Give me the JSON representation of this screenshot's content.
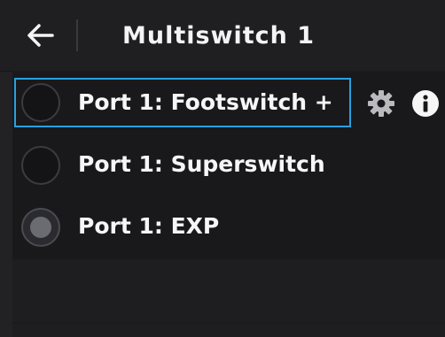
{
  "header": {
    "title": "Multiswitch 1",
    "back_icon": "arrow-left-icon"
  },
  "ports": [
    {
      "label": "Port 1: Footswitch +",
      "state": "unselected",
      "focused": true
    },
    {
      "label": "Port 1: Superswitch",
      "state": "unselected",
      "focused": false
    },
    {
      "label": "Port 1: EXP",
      "state": "pressed",
      "focused": false
    }
  ],
  "actions": {
    "settings_icon": "gear-icon",
    "info_icon": "info-icon"
  },
  "colors": {
    "focus_outline": "#29a0e0",
    "background": "#222225",
    "text": "#f6f6f6"
  }
}
